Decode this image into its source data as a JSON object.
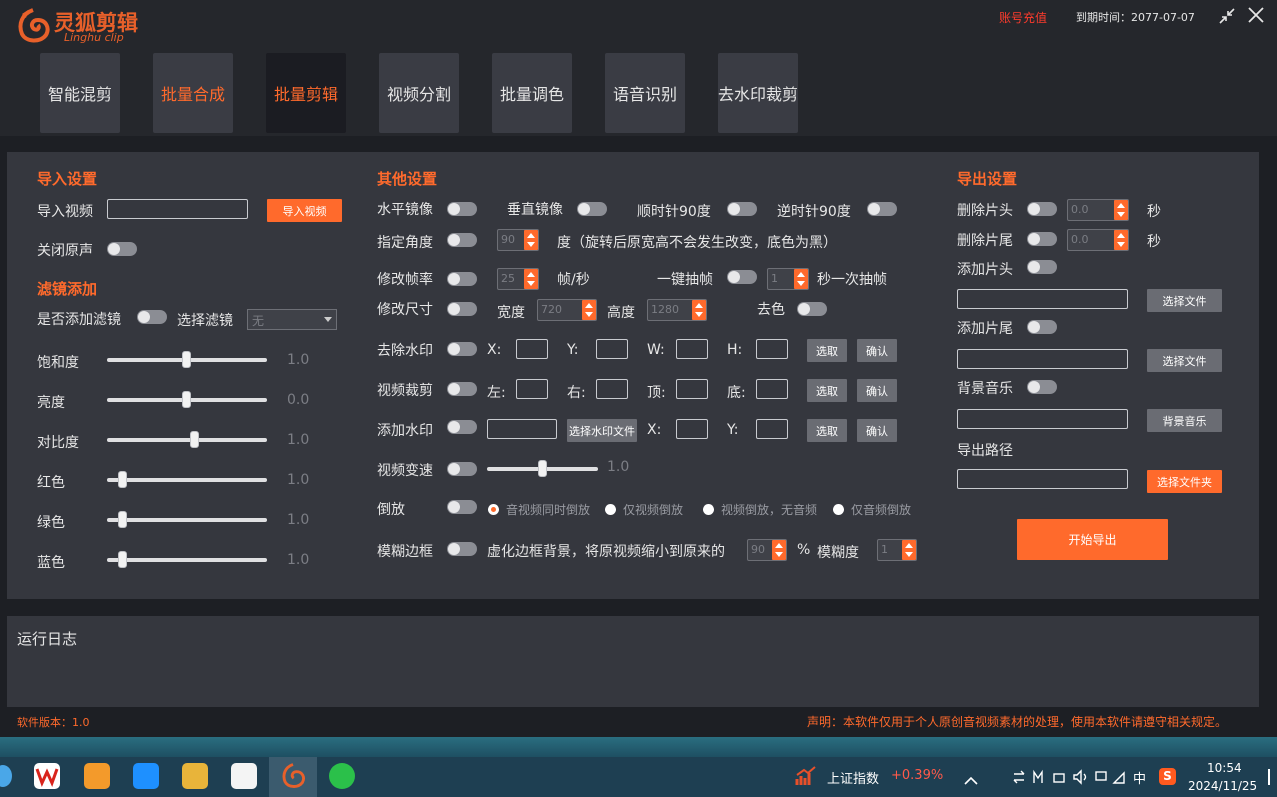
{
  "app": {
    "logo_text": "灵狐剪辑",
    "logo_sub": "Linghu clip",
    "recharge": "账号充值",
    "expire": "到期时间：2077-07-07"
  },
  "tabs": [
    {
      "label": "智能混剪",
      "state": "normal"
    },
    {
      "label": "批量合成",
      "state": "orange"
    },
    {
      "label": "批量剪辑",
      "state": "active"
    },
    {
      "label": "视频分割",
      "state": "normal"
    },
    {
      "label": "批量调色",
      "state": "normal"
    },
    {
      "label": "语音识别",
      "state": "normal"
    },
    {
      "label": "去水印裁剪",
      "state": "normal"
    }
  ],
  "import": {
    "title": "导入设置",
    "video_label": "导入视频",
    "import_btn": "导入视频",
    "mute_label": "关闭原声"
  },
  "filter": {
    "title": "滤镜添加",
    "add_label": "是否添加滤镜",
    "select_label": "选择滤镜",
    "select_value": "无",
    "sliders": [
      {
        "label": "饱和度",
        "value": "1.0",
        "pos": 0.5
      },
      {
        "label": "亮度",
        "value": "0.0",
        "pos": 0.5
      },
      {
        "label": "对比度",
        "value": "1.0",
        "pos": 0.55
      },
      {
        "label": "红色",
        "value": "1.0",
        "pos": 0.1
      },
      {
        "label": "绿色",
        "value": "1.0",
        "pos": 0.1
      },
      {
        "label": "蓝色",
        "value": "1.0",
        "pos": 0.1
      }
    ]
  },
  "other": {
    "title": "其他设置",
    "hmirror": "水平镜像",
    "vmirror": "垂直镜像",
    "cw90": "顺时针90度",
    "ccw90": "逆时针90度",
    "angle": "指定角度",
    "angle_value": "90",
    "angle_note": "度（旋转后原宽高不会发生改变，底色为黑）",
    "fps": "修改帧率",
    "fps_value": "25",
    "fps_unit": "帧/秒",
    "extract": "一键抽帧",
    "extract_value": "1",
    "extract_unit": "秒一次抽帧",
    "resize": "修改尺寸",
    "width_label": "宽度",
    "width_value": "720",
    "height_label": "高度",
    "height_value": "1280",
    "decolor": "去色",
    "remove_wm": "去除水印",
    "x": "X:",
    "y": "Y:",
    "w": "W:",
    "h": "H:",
    "pick": "选取",
    "confirm": "确认",
    "crop": "视频裁剪",
    "left": "左:",
    "right": "右:",
    "top": "顶:",
    "bottom": "底:",
    "add_wm": "添加水印",
    "choose_wm": "选择水印文件",
    "speed": "视频变速",
    "speed_value": "1.0",
    "speed_pos": 0.5,
    "reverse": "倒放",
    "reverse_opts": [
      "音视频同时倒放",
      "仅视频倒放",
      "视频倒放，无音频",
      "仅音频倒放"
    ],
    "blur": "模糊边框",
    "blur_note": "虚化边框背景，将原视频缩小到原来的",
    "blur_value": "90",
    "percent": "%",
    "blur_level": "模糊度",
    "blur_level_value": "1"
  },
  "export": {
    "title": "导出设置",
    "del_head": "删除片头",
    "del_head_value": "0.0",
    "del_tail": "删除片尾",
    "del_tail_value": "0.0",
    "sec": "秒",
    "add_head": "添加片头",
    "add_tail": "添加片尾",
    "choose_file": "选择文件",
    "bgm": "背景音乐",
    "bgm_btn": "背景音乐",
    "path": "导出路径",
    "choose_folder": "选择文件夹",
    "start": "开始导出"
  },
  "log": {
    "title": "运行日志"
  },
  "footer": {
    "version": "软件版本：1.0",
    "notice": "声明：本软件仅用于个人原创音视频素材的处理，使用本软件请遵守相关规定。"
  },
  "taskbar": {
    "stock_name": "上证指数",
    "stock_change": "+0.39%",
    "ime": "中",
    "time": "10:54",
    "date": "2024/11/25"
  }
}
